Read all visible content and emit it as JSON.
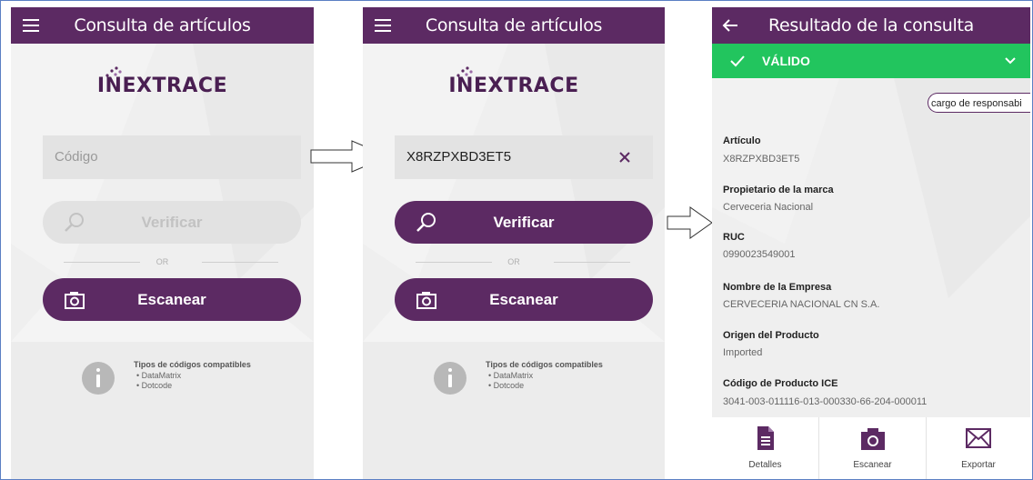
{
  "screen1": {
    "title": "Consulta de artículos",
    "logo": "INEXTRACE",
    "code_placeholder": "Código",
    "verify_label": "Verificar",
    "or_label": "OR",
    "scan_label": "Escanear",
    "info_heading": "Tipos de códigos compatibles",
    "info_items": [
      "• DataMatrix",
      "• Dotcode"
    ]
  },
  "screen2": {
    "title": "Consulta de artículos",
    "logo": "INEXTRACE",
    "code_value": "X8RZPXBD3ET5",
    "verify_label": "Verificar",
    "or_label": "OR",
    "scan_label": "Escanear",
    "info_heading": "Tipos de códigos compatibles",
    "info_items": [
      "• DataMatrix",
      "• Dotcode"
    ]
  },
  "screen3": {
    "title": "Resultado de la consulta",
    "status": "VÁLIDO",
    "responsible_button": "cargo de responsabi",
    "fields": [
      {
        "label": "Artículo",
        "value": "X8RZPXBD3ET5"
      },
      {
        "label": "Propietario de la marca",
        "value": "Cerveceria Nacional"
      },
      {
        "label": "RUC",
        "value": "0990023549001"
      },
      {
        "label": "Nombre de la Empresa",
        "value": "CERVECERIA NACIONAL CN S.A."
      },
      {
        "label": "Origen del Producto",
        "value": "Imported"
      },
      {
        "label": "Código de Producto ICE",
        "value": "3041-003-011116-013-000330-66-204-000011"
      }
    ],
    "nav": [
      "Detalles",
      "Escanear",
      "Exportar"
    ]
  },
  "colors": {
    "brand_purple": "#5c2a63",
    "valid_green": "#22c55e",
    "disabled_gray": "#e2e2e2"
  },
  "icons": [
    "menu-icon",
    "back-arrow-icon",
    "search-icon",
    "camera-icon",
    "info-icon",
    "check-icon",
    "chevron-down-icon",
    "document-icon",
    "mail-icon",
    "clear-icon",
    "right-arrow-icon"
  ]
}
